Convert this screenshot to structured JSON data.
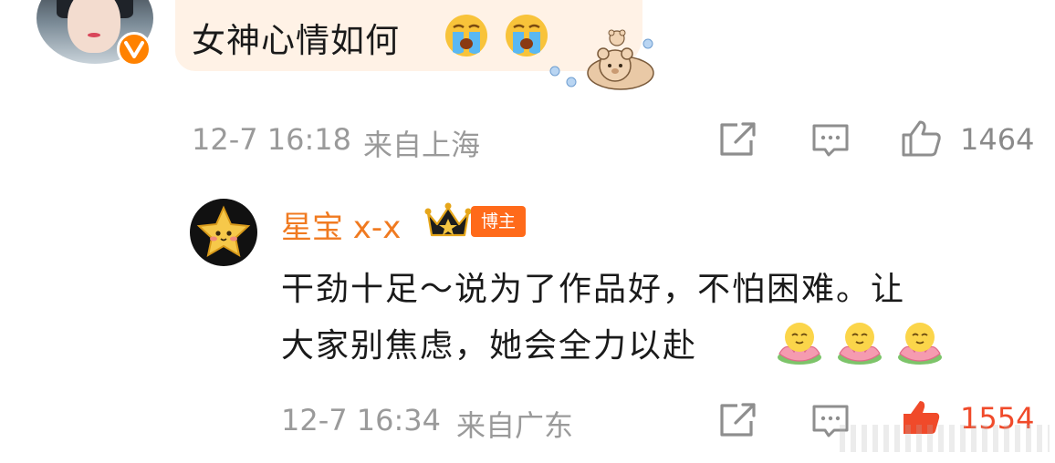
{
  "comment": {
    "text": "女神心情如何",
    "emojis": [
      "crying-face-emoji",
      "crying-face-emoji"
    ],
    "sticker": "bear-sticker",
    "timestamp": "12-7 16:18",
    "location": "来自上海",
    "like_count": "1464",
    "verified_color": "#ff8200",
    "bubble_color": "#fff2e6"
  },
  "reply": {
    "author": "星宝 x-x",
    "badge": "博主",
    "line1": "干劲十足～说为了作品好，不怕困难。让",
    "line2": "大家别焦虑，她会全力以赴",
    "emojis": [
      "lotus-emoji",
      "lotus-emoji",
      "lotus-emoji"
    ],
    "timestamp": "12-7 16:34",
    "location": "来自广东",
    "like_count": "1554",
    "name_color": "#f07a20",
    "liked_color": "#f04a2a"
  },
  "icons": {
    "share": "share-icon",
    "comment": "comment-icon",
    "like": "thumbs-up-icon"
  }
}
